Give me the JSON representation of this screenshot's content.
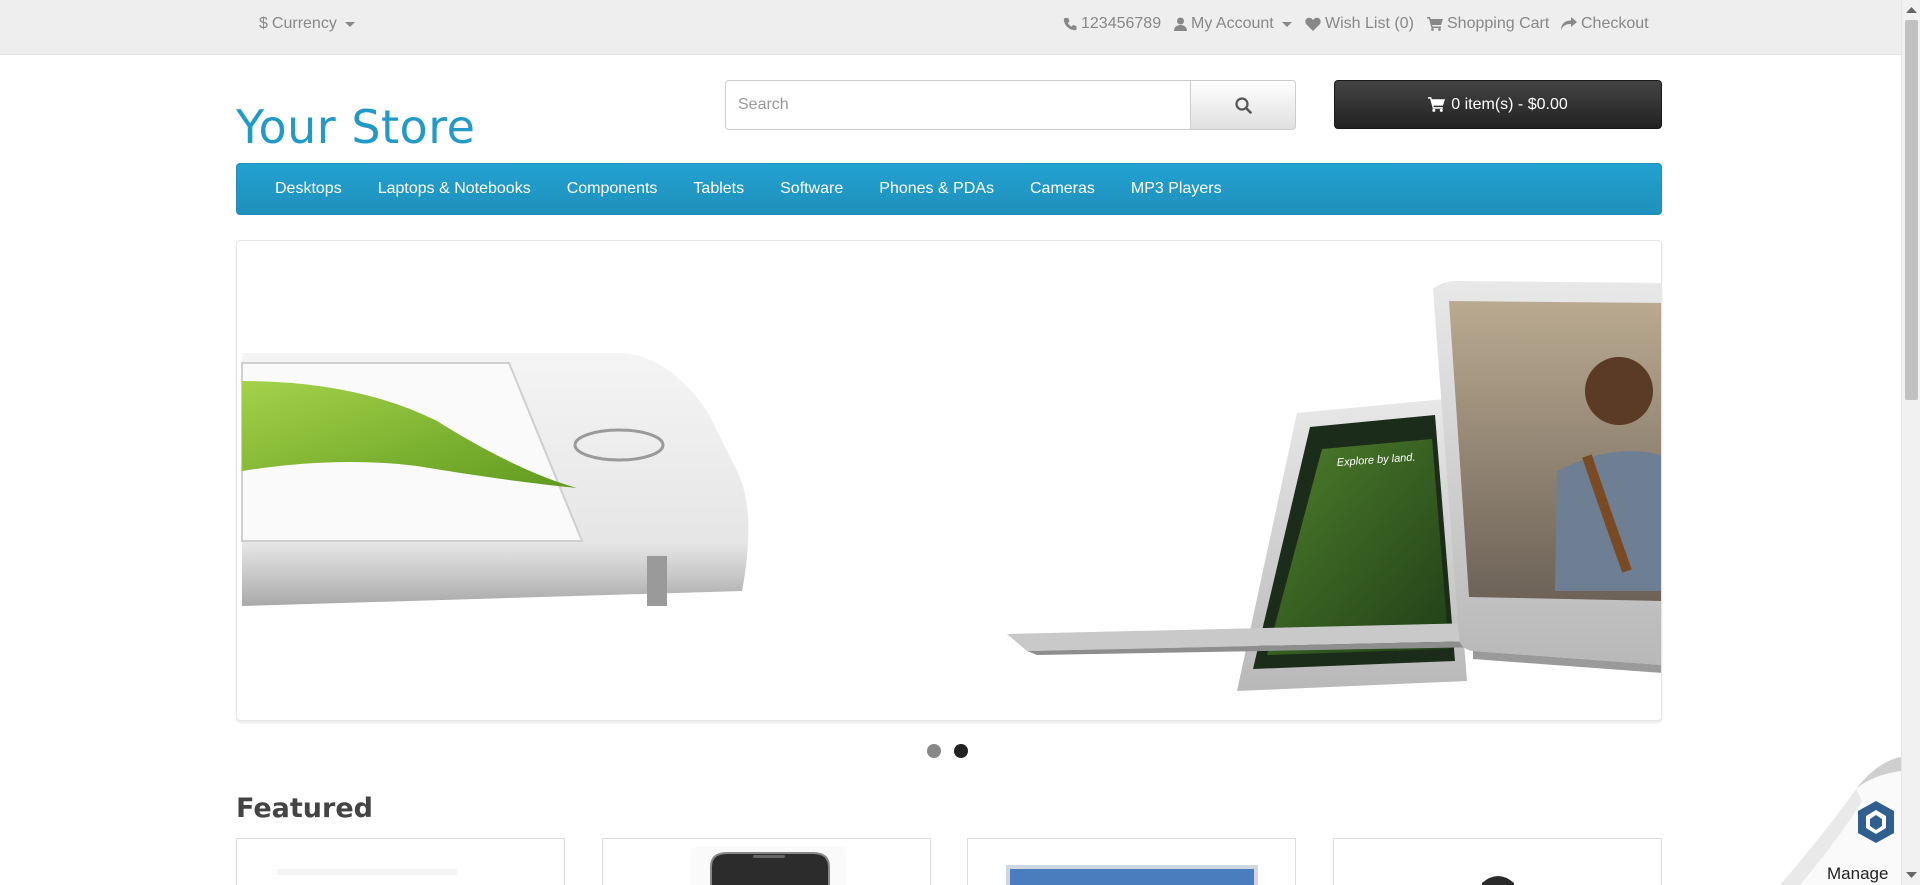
{
  "topbar": {
    "currency_label": "Currency",
    "phone": "123456789",
    "account_label": "My Account",
    "wishlist_label": "Wish List (0)",
    "cart_label": "Shopping Cart",
    "checkout_label": "Checkout"
  },
  "header": {
    "store_name": "Your Store",
    "search_placeholder": "Search",
    "cart_button": "0 item(s) - $0.00"
  },
  "menu": {
    "items": [
      "Desktops",
      "Laptops & Notebooks",
      "Components",
      "Tablets",
      "Software",
      "Phones & PDAs",
      "Cameras",
      "MP3 Players"
    ]
  },
  "slideshow": {
    "dots_count": 2,
    "active_dot": 2
  },
  "featured": {
    "title": "Featured"
  },
  "widget": {
    "manage_label": "Manage"
  },
  "colors": {
    "brand": "#229ac8",
    "menu_bg": "#229ac8",
    "cart_bg": "#333333"
  }
}
